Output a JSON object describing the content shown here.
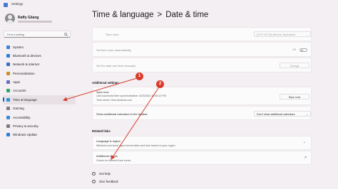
{
  "window": {
    "title": "Settings"
  },
  "user": {
    "name": "Raffy Gilang"
  },
  "search": {
    "placeholder": "Find a setting"
  },
  "nav": [
    {
      "label": "System",
      "color": "#3f7fd6"
    },
    {
      "label": "Bluetooth & devices",
      "color": "#2b80d6"
    },
    {
      "label": "Network & internet",
      "color": "#3a6fc0"
    },
    {
      "label": "Personalization",
      "color": "#d18a2a"
    },
    {
      "label": "Apps",
      "color": "#6b6bbf"
    },
    {
      "label": "Accounts",
      "color": "#2fa36b"
    },
    {
      "label": "Time & language",
      "color": "#2d8fd6",
      "selected": true
    },
    {
      "label": "Gaming",
      "color": "#808080"
    },
    {
      "label": "Accessibility",
      "color": "#3a8ad6"
    },
    {
      "label": "Privacy & security",
      "color": "#7a7a7a"
    },
    {
      "label": "Windows Update",
      "color": "#2b80d6"
    }
  ],
  "breadcrumb": {
    "parent": "Time & language",
    "separator": ">",
    "current": "Date & time"
  },
  "timezone": {
    "label": "Time zone",
    "value": "(UTC+02:00) Athens, Bucharest"
  },
  "set_time_auto": {
    "label": "Set time zone automatically",
    "state": "Off"
  },
  "set_manual": {
    "label": "Set the date and time manually",
    "button": "Change"
  },
  "additional_settings": {
    "heading": "Additional settings",
    "sync": {
      "label": "Sync now",
      "line1": "Last successful time synchronization: 5/23/2023 10:08:12 PM",
      "line2": "Time server: time.windows.com",
      "button": "Sync now"
    },
    "calendars": {
      "label": "Show additional calendars in the taskbar",
      "value": "Don't show additional calendars"
    }
  },
  "related_links": {
    "heading": "Related links",
    "language_region": {
      "label": "Language & region",
      "desc": "Windows and some apps format dates and time based on your region"
    },
    "additional_clocks": {
      "label": "Additional clocks",
      "desc": "Clocks for different time zones"
    }
  },
  "help": {
    "get_help": "Get help",
    "feedback": "Give feedback"
  },
  "annotations": {
    "marker1": "1",
    "marker2": "2",
    "color": "#d93a2b"
  }
}
